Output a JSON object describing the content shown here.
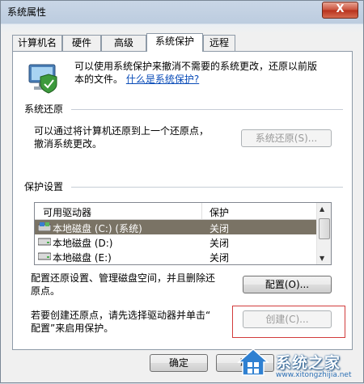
{
  "window": {
    "title": "系统属性",
    "close_glyph": "X"
  },
  "tabs": [
    {
      "label": "计算机名",
      "active": false
    },
    {
      "label": "硬件",
      "active": false
    },
    {
      "label": "高级",
      "active": false
    },
    {
      "label": "系统保护",
      "active": true
    },
    {
      "label": "远程",
      "active": false
    }
  ],
  "intro": {
    "line1": "可以使用系统保护来撤消不需要的系统更改，还原以前版",
    "line2_prefix": "本的文件。",
    "link": "什么是系统保护?",
    "icon": "system-protection-shield-icon"
  },
  "restore_section": {
    "title": "系统还原",
    "desc_line1": "可以通过将计算机还原到上一个还原点，",
    "desc_line2": "撤消系统更改。",
    "button": "系统还原(S)..."
  },
  "protection_section": {
    "title": "保护设置",
    "columns": [
      "可用驱动器",
      "保护"
    ],
    "drives": [
      {
        "name": "本地磁盘 (C:) (系统)",
        "protection": "关闭",
        "selected": true,
        "icon": "system-drive-icon"
      },
      {
        "name": "本地磁盘 (D:)",
        "protection": "关闭",
        "selected": false,
        "icon": "hard-drive-icon"
      },
      {
        "name": "本地磁盘 (E:)",
        "protection": "关闭",
        "selected": false,
        "icon": "hard-drive-icon"
      }
    ],
    "config_desc_line1": "配置还原设置、管理磁盘空间，并且删除还",
    "config_desc_line2": "原点。",
    "config_button": "配置(O)...",
    "create_desc_line1": "若要创建还原点，请先选择驱动器并单击“",
    "create_desc_line2": "配置”来启用保护。",
    "create_button": "创建(C)..."
  },
  "footer": {
    "ok_button": "确定",
    "cancel_button": "取"
  },
  "watermark": {
    "brand": "系统之家",
    "url": "www.xitongzhijia.net"
  },
  "colors": {
    "selection": "#7a7365",
    "link": "#0a4cb8",
    "highlight_box": "#d23c3c"
  }
}
